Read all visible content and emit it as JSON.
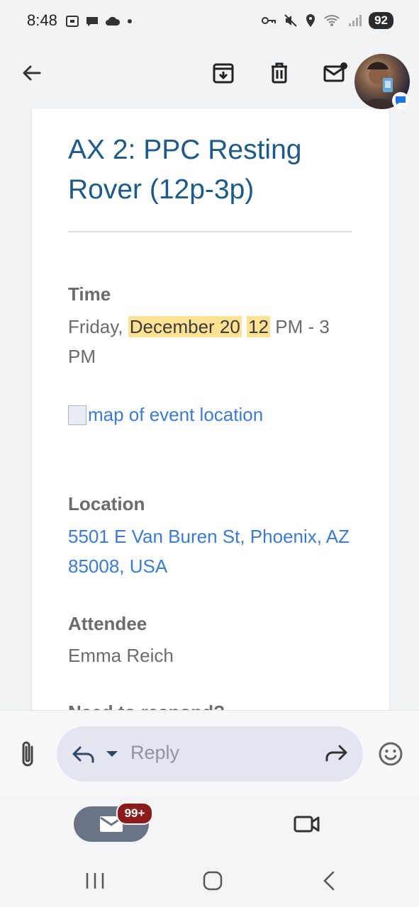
{
  "status_bar": {
    "time": "8:48",
    "battery": "92"
  },
  "email": {
    "title": "AX 2: PPC Resting Rover (12p-3p)",
    "time_label": "Time",
    "time_parts": [
      "Friday, ",
      "December 20",
      " ",
      "12",
      " PM - 3 PM"
    ],
    "map_alt": "map of event location",
    "location_label": "Location",
    "location_value": "5501 E Van Buren St, Phoenix, AZ 85008, USA",
    "attendee_label": "Attendee",
    "attendee_value": "Emma Reich",
    "cutoff_label": "Need to respond?"
  },
  "reply_bar": {
    "placeholder": "Reply"
  },
  "bottom_tabs": {
    "mail_badge": "99+"
  },
  "icons": {
    "back": "arrow-left-icon",
    "archive": "archive-icon",
    "delete": "trash-icon",
    "mark_unread": "mail-unread-icon",
    "attach": "paperclip-icon",
    "reply": "reply-icon",
    "forward": "forward-icon",
    "emoji": "emoji-icon",
    "mail": "mail-icon",
    "meet": "video-icon"
  },
  "colors": {
    "title": "#1b5a8a",
    "link": "#3a7bd5",
    "highlight": "#fde293",
    "badge": "#8c1b1b"
  }
}
